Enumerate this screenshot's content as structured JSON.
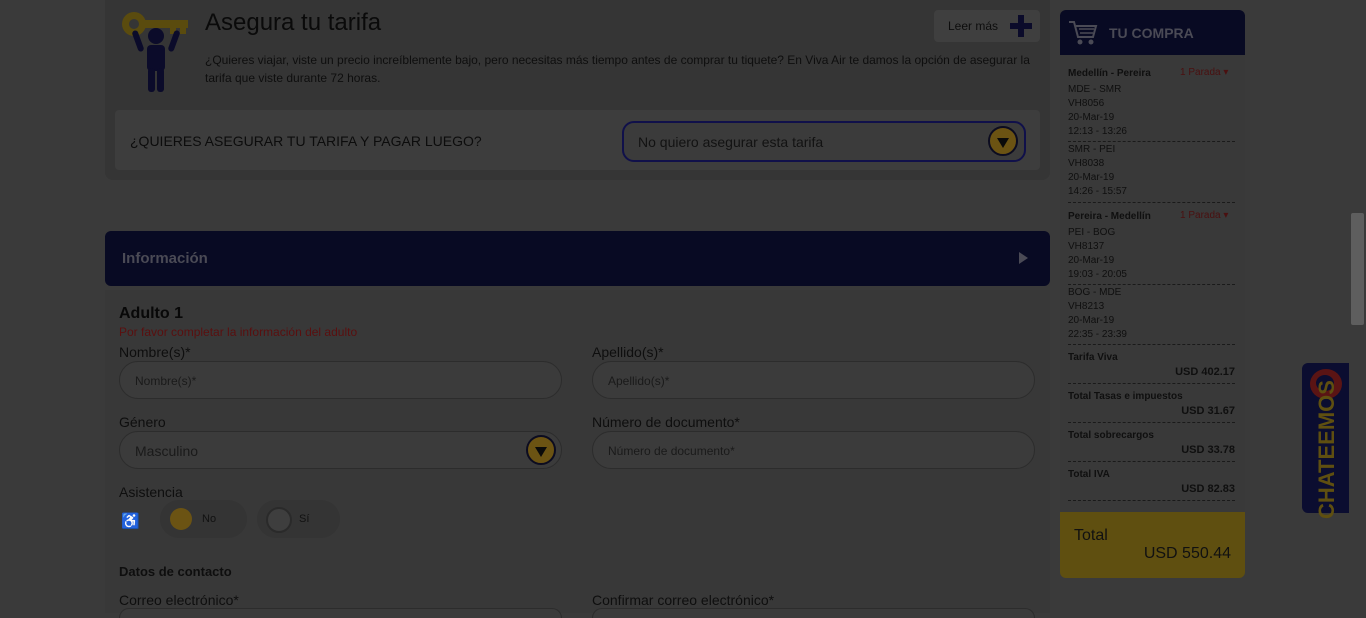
{
  "fare_lock": {
    "title": "Asegura tu tarifa",
    "read_more": "Leer más",
    "description": "¿Quieres viajar, viste un precio increíblemente bajo, pero necesitas más tiempo antes de comprar tu tiquete? En Viva Air te damos la opción de asegurar la tarifa que viste durante 72 horas.",
    "question": "¿QUIERES ASEGURAR TU TARIFA Y PAGAR LUEGO?",
    "selected_option": "No quiero asegurar esta tarifa"
  },
  "info_section": {
    "title": "Información"
  },
  "form": {
    "adult_title": "Adulto 1",
    "warning": "Por favor completar la información del adulto",
    "first_name_label": "Nombre(s)*",
    "first_name_placeholder": "Nombre(s)*",
    "last_name_label": "Apellido(s)*",
    "last_name_placeholder": "Apellido(s)*",
    "gender_label": "Género",
    "gender_value": "Masculino",
    "doc_label": "Número de documento*",
    "doc_placeholder": "Número de documento*",
    "assistance_label": "Asistencia",
    "assistance_no": "No",
    "assistance_yes": "Sí",
    "contact_title": "Datos de contacto",
    "email_label": "Correo electrónico*",
    "confirm_email_label": "Confirmar correo electrónico*"
  },
  "purchase": {
    "title": "TU COMPRA",
    "route1": {
      "name": "Medellín - Pereira",
      "stops": "1 Parada ▾",
      "segments": [
        {
          "code": "MDE - SMR",
          "flight": "VH8056",
          "date": "20-Mar-19",
          "time": "12:13 - 13:26"
        },
        {
          "code": "SMR - PEI",
          "flight": "VH8038",
          "date": "20-Mar-19",
          "time": "14:26 - 15:57"
        }
      ]
    },
    "route2": {
      "name": "Pereira - Medellín",
      "stops": "1 Parada ▾",
      "segments": [
        {
          "code": "PEI - BOG",
          "flight": "VH8137",
          "date": "20-Mar-19",
          "time": "19:03 - 20:05"
        },
        {
          "code": "BOG - MDE",
          "flight": "VH8213",
          "date": "20-Mar-19",
          "time": "22:35 - 23:39"
        }
      ]
    },
    "fare_label": "Tarifa Viva",
    "fare_value": "USD 402.17",
    "taxes_label": "Total Tasas e impuestos",
    "taxes_value": "USD 31.67",
    "surcharges_label": "Total sobrecargos",
    "surcharges_value": "USD 33.78",
    "iva_label": "Total IVA",
    "iva_value": "USD 82.83",
    "total_label": "Total",
    "total_value": "USD 550.44"
  },
  "chat": {
    "label": "CHATEEMOS"
  }
}
